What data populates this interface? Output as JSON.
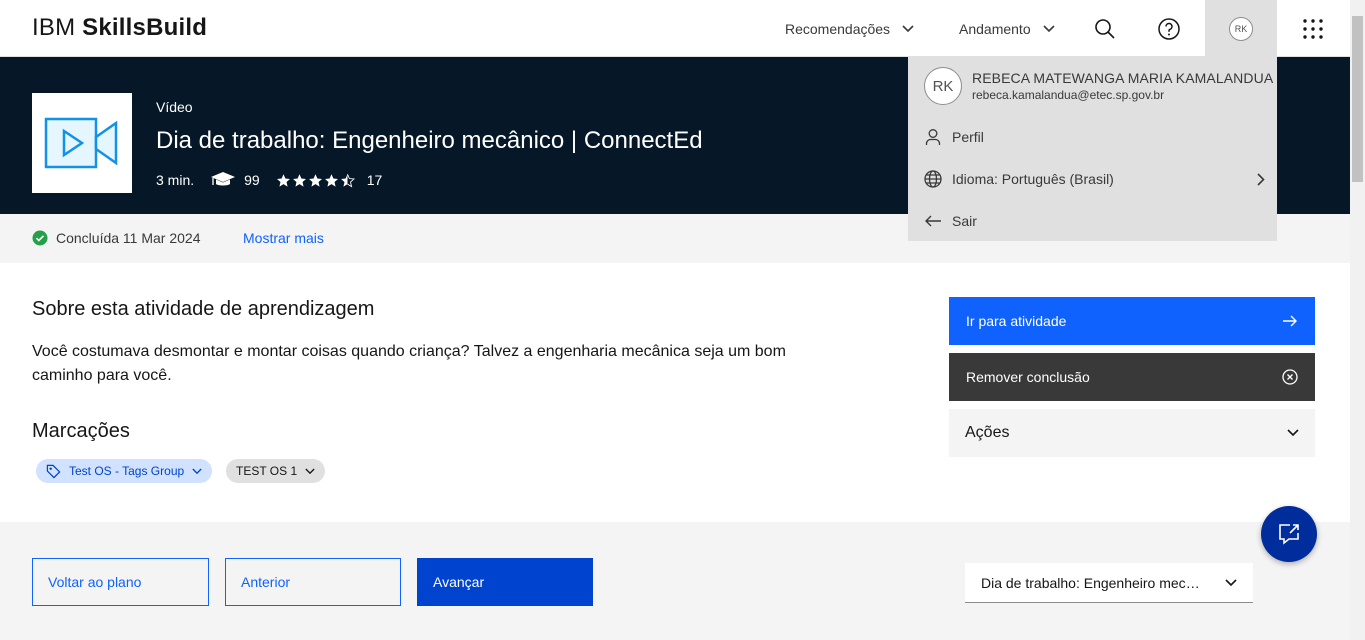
{
  "header": {
    "logo_light": "IBM",
    "logo_bold": "SkillsBuild",
    "nav": [
      {
        "label": "Recomendações"
      },
      {
        "label": "Andamento"
      }
    ],
    "avatar_initials": "RK"
  },
  "hero": {
    "type": "Vídeo",
    "title": "Dia de trabalho: Engenheiro mecânico | ConnectEd",
    "duration": "3 min.",
    "learners": "99",
    "rating_count": "17",
    "rating": 4.5
  },
  "status": {
    "completed": "Concluída 11 Mar 2024",
    "more_link": "Mostrar mais"
  },
  "about": {
    "title": "Sobre esta atividade de aprendizagem",
    "text": "Você costumava desmontar e montar coisas quando criança? Talvez a engenharia mecânica seja um bom caminho para você."
  },
  "tags": {
    "title": "Marcações",
    "items": [
      {
        "label": "Test OS - Tags Group"
      },
      {
        "label": "TEST OS 1"
      }
    ]
  },
  "actions": {
    "go_label": "Ir para atividade",
    "remove_label": "Remover conclusão",
    "accordion_label": "Ações"
  },
  "footer": {
    "back_label": "Voltar ao plano",
    "prev_label": "Anterior",
    "next_label": "Avançar",
    "select_value": "Dia de trabalho: Engenheiro mecânico | ConnectEd"
  },
  "user_menu": {
    "initials": "RK",
    "name": "REBECA MATEWANGA MARIA KAMALANDUA",
    "email": "rebeca.kamalandua@etec.sp.gov.br",
    "profile_label": "Perfil",
    "language_label": "Idioma: Português (Brasil)",
    "logout_label": "Sair"
  },
  "colors": {
    "primary": "#0f62fe",
    "hero_bg": "#061727",
    "success": "#24a148"
  }
}
